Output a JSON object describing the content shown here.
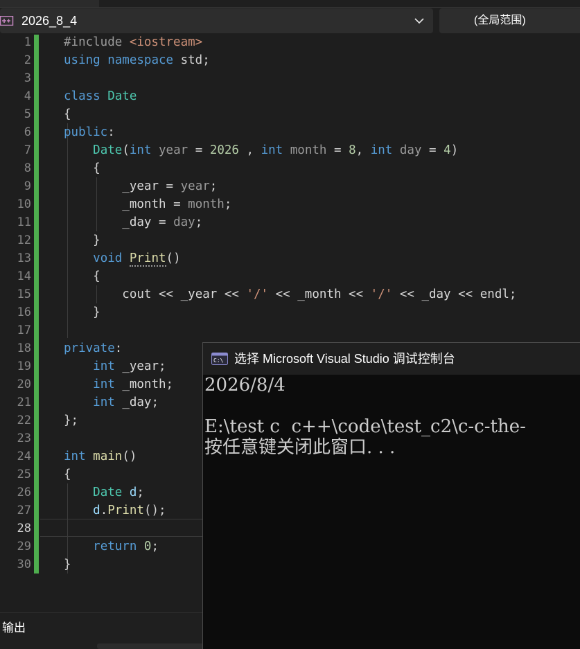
{
  "navbar": {
    "project_name": "2026_8_4",
    "scope": "(全局范围)"
  },
  "editor": {
    "line_numbers": [
      "1",
      "2",
      "3",
      "4",
      "5",
      "6",
      "7",
      "8",
      "9",
      "10",
      "11",
      "12",
      "13",
      "14",
      "15",
      "16",
      "17",
      "18",
      "19",
      "20",
      "21",
      "22",
      "23",
      "24",
      "25",
      "26",
      "27",
      "28",
      "29",
      "30"
    ],
    "current_line": "28",
    "code_lines": [
      "#include <iostream>",
      "using namespace std;",
      "",
      "class Date",
      "{",
      "public:",
      "    Date(int year = 2026 , int month = 8, int day = 4)",
      "    {",
      "        _year = year;",
      "        _month = month;",
      "        _day = day;",
      "    }",
      "    void Print()",
      "    {",
      "        cout << _year << '/' << _month << '/' << _day << endl;",
      "    }",
      "",
      "private:",
      "    int _year;",
      "    int _month;",
      "    int _day;",
      "};",
      "",
      "int main()",
      "{",
      "    Date d;",
      "    d.Print();",
      "",
      "    return 0;",
      "}"
    ]
  },
  "console": {
    "title": "选择 Microsoft Visual Studio 调试控制台",
    "lines": [
      "2026/8/4",
      "",
      "E:\\test c  c++\\code\\test_c2\\c-c-the-",
      "按任意键关闭此窗口. . ."
    ]
  },
  "output_panel": {
    "label": "输出"
  },
  "colors": {
    "editor_bg": "#1e1e1e",
    "keyword": "#569cd6",
    "type": "#4ec9b0",
    "function": "#dcdcaa",
    "number": "#b5cea8",
    "string": "#ce9178",
    "change_bar": "#4ead4e",
    "console_bg": "#0c0c0c"
  },
  "icons": {
    "project": "project-file-icon",
    "dropdown": "chevron-down-icon",
    "console": "console-app-icon"
  }
}
